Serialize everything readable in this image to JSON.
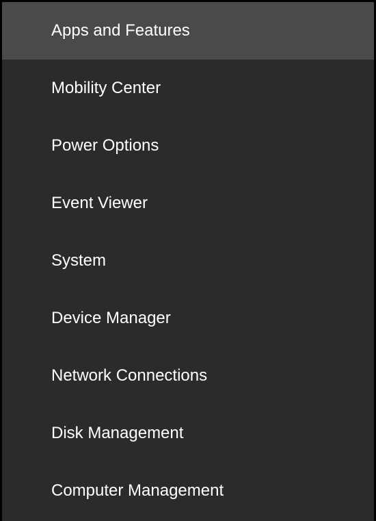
{
  "menu": {
    "items": [
      {
        "label": "Apps and Features",
        "hovered": true
      },
      {
        "label": "Mobility Center",
        "hovered": false
      },
      {
        "label": "Power Options",
        "hovered": false
      },
      {
        "label": "Event Viewer",
        "hovered": false
      },
      {
        "label": "System",
        "hovered": false
      },
      {
        "label": "Device Manager",
        "hovered": false
      },
      {
        "label": "Network Connections",
        "hovered": false
      },
      {
        "label": "Disk Management",
        "hovered": false
      },
      {
        "label": "Computer Management",
        "hovered": false
      }
    ]
  }
}
